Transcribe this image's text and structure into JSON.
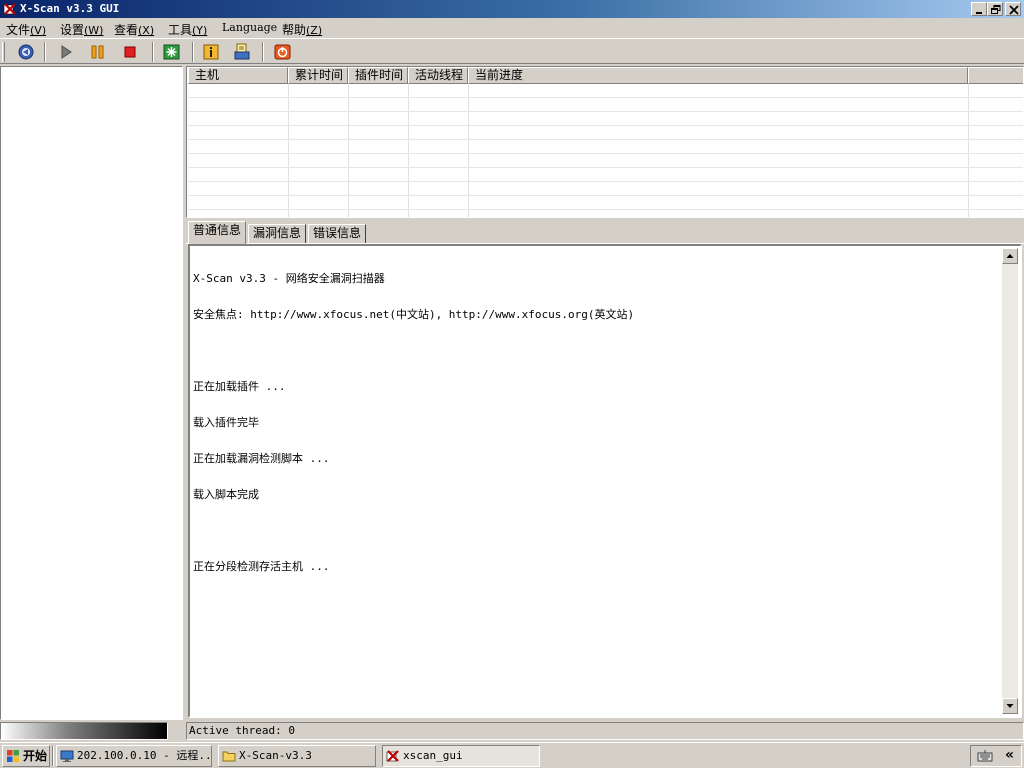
{
  "window": {
    "title": "X-Scan v3.3 GUI"
  },
  "menu": [
    {
      "label": "文件",
      "hotkey": "(V)"
    },
    {
      "label": "设置",
      "hotkey": "(W)"
    },
    {
      "label": "查看",
      "hotkey": "(X)"
    },
    {
      "label": "工具",
      "hotkey": "(Y)"
    },
    {
      "label": "Language",
      "hotkey": ""
    },
    {
      "label": "帮助",
      "hotkey": "(Z)"
    }
  ],
  "toolbar": {
    "buttons": [
      "connect-icon",
      "start-icon",
      "pause-icon",
      "stop-icon",
      "plugin-icon",
      "info-icon",
      "report-icon",
      "exit-icon"
    ]
  },
  "host_table": {
    "columns": [
      "主机",
      "累计时间",
      "插件时间",
      "活动线程",
      "当前进度"
    ]
  },
  "tabs": [
    "普通信息",
    "漏洞信息",
    "错误信息"
  ],
  "log": {
    "lines": [
      "X-Scan v3.3 - 网络安全漏洞扫描器",
      "安全焦点: http://www.xfocus.net(中文站), http://www.xfocus.org(英文站)",
      "",
      "正在加载插件 ...",
      "载入插件完毕",
      "正在加载漏洞检测脚本 ...",
      "载入脚本完成",
      "",
      "正在分段检测存活主机 ..."
    ]
  },
  "status": {
    "text": "Active thread: 0"
  },
  "taskbar": {
    "start_label": "开始",
    "tasks": [
      "202.100.0.10 - 远程...",
      "X-Scan-v3.3",
      "xscan_gui"
    ],
    "tray_chevron": "«"
  },
  "colors": {
    "title_start": "#0a246a",
    "title_end": "#a6caf0",
    "face": "#d4d0c8"
  }
}
